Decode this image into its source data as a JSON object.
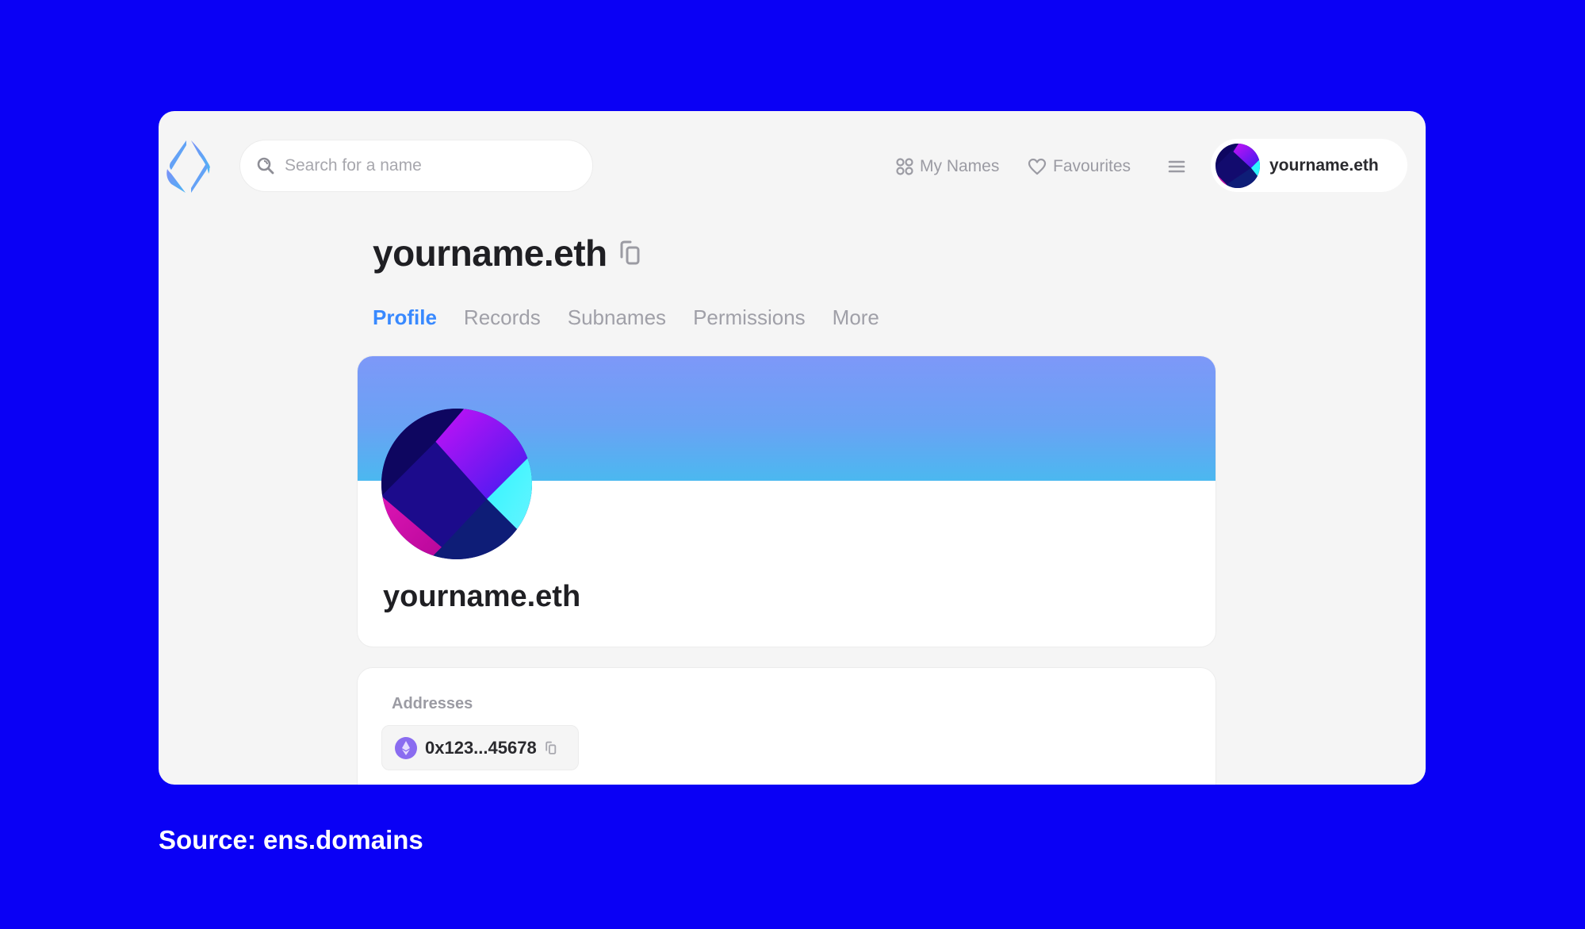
{
  "header": {
    "logo": "ens-logo-icon",
    "search": {
      "placeholder": "Search for a name",
      "value": ""
    },
    "nav": [
      {
        "label": "My Names",
        "icon": "grid-icon"
      },
      {
        "label": "Favourites",
        "icon": "heart-icon"
      }
    ],
    "menu_icon": "hamburger-menu-icon",
    "account": {
      "name": "yourname.eth"
    }
  },
  "page": {
    "title": "yourname.eth",
    "tabs": [
      {
        "label": "Profile",
        "active": true
      },
      {
        "label": "Records",
        "active": false
      },
      {
        "label": "Subnames",
        "active": false
      },
      {
        "label": "Permissions",
        "active": false
      },
      {
        "label": "More",
        "active": false
      }
    ]
  },
  "profile": {
    "name": "yourname.eth",
    "banner_colors": [
      "#7d98f8",
      "#4bb8f0"
    ]
  },
  "addresses": {
    "label": "Addresses",
    "items": [
      {
        "coin": "ETH",
        "address": "0x123...45678"
      }
    ]
  },
  "caption": "Source: ens.domains",
  "colors": {
    "background": "#0a00f5",
    "accent": "#3889ff",
    "eth": "#8a6cf0"
  }
}
